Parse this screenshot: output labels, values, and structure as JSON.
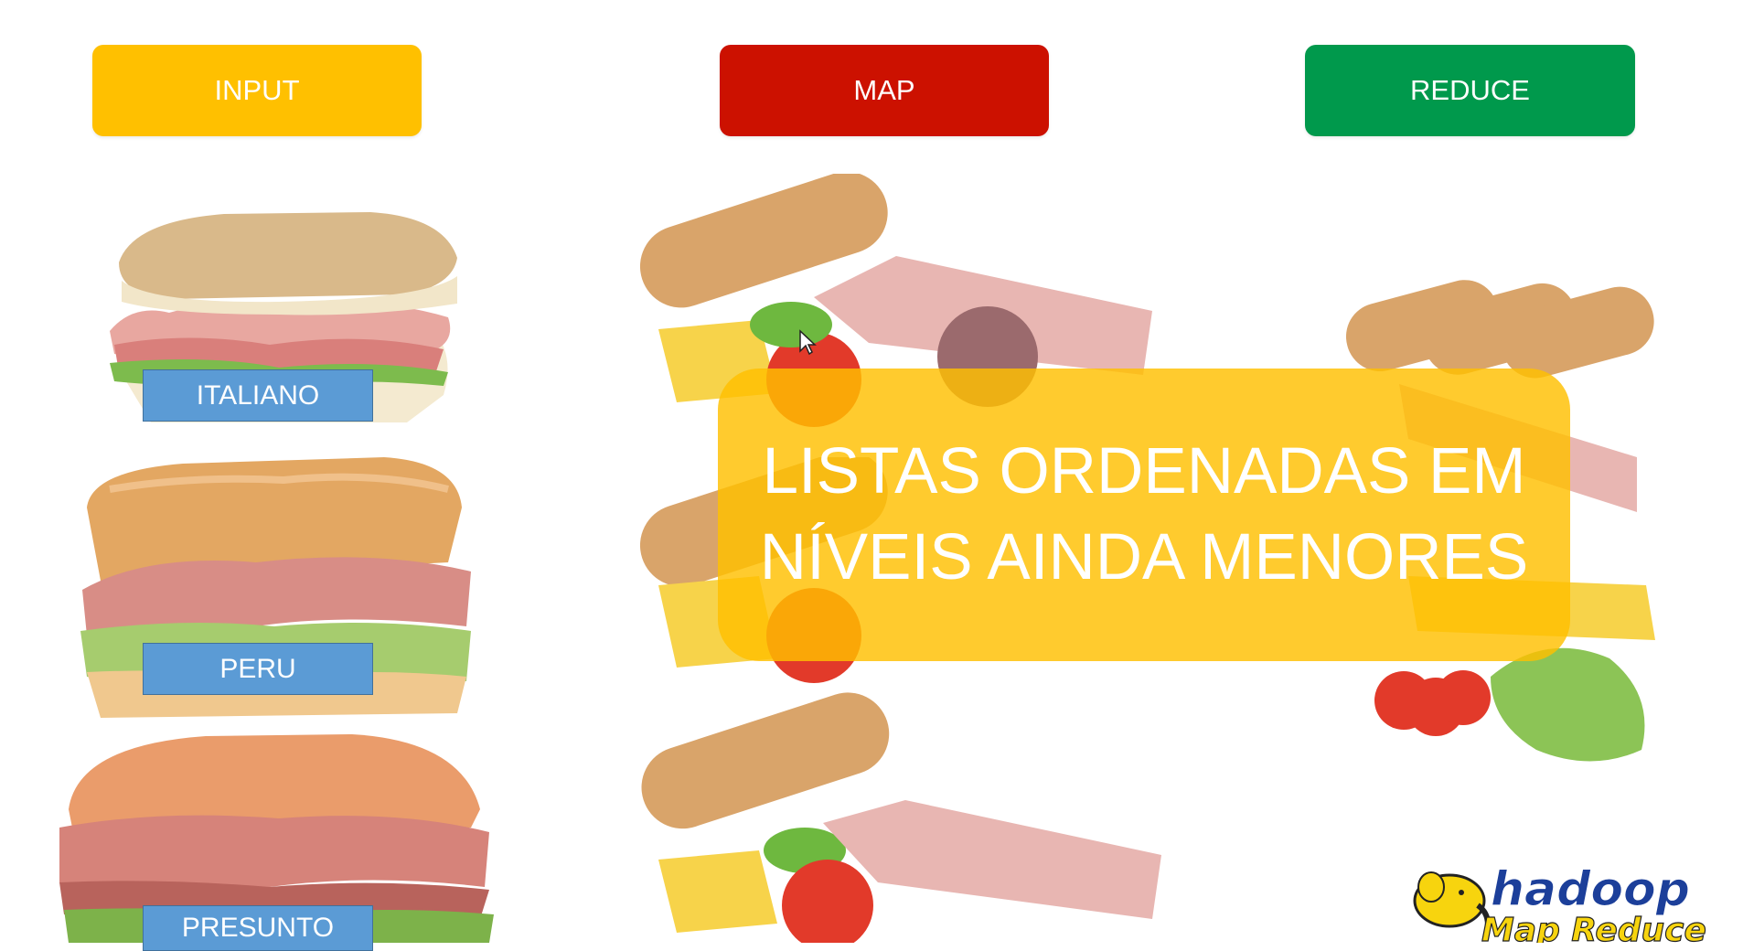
{
  "headers": {
    "input": "INPUT",
    "map": "MAP",
    "reduce": "REDUCE"
  },
  "colors": {
    "input": "#ffc000",
    "map": "#cc1100",
    "reduce": "#00994c",
    "label": "#5b9bd5"
  },
  "sandwiches": [
    {
      "label": "ITALIANO"
    },
    {
      "label": "PERU"
    },
    {
      "label": "PRESUNTO"
    }
  ],
  "overlay": {
    "line1": "LISTAS ORDENADAS EM",
    "line2": "NÍVEIS AINDA MENORES"
  },
  "logo": {
    "line1": "hadoop",
    "line2": "Map Reduce"
  }
}
